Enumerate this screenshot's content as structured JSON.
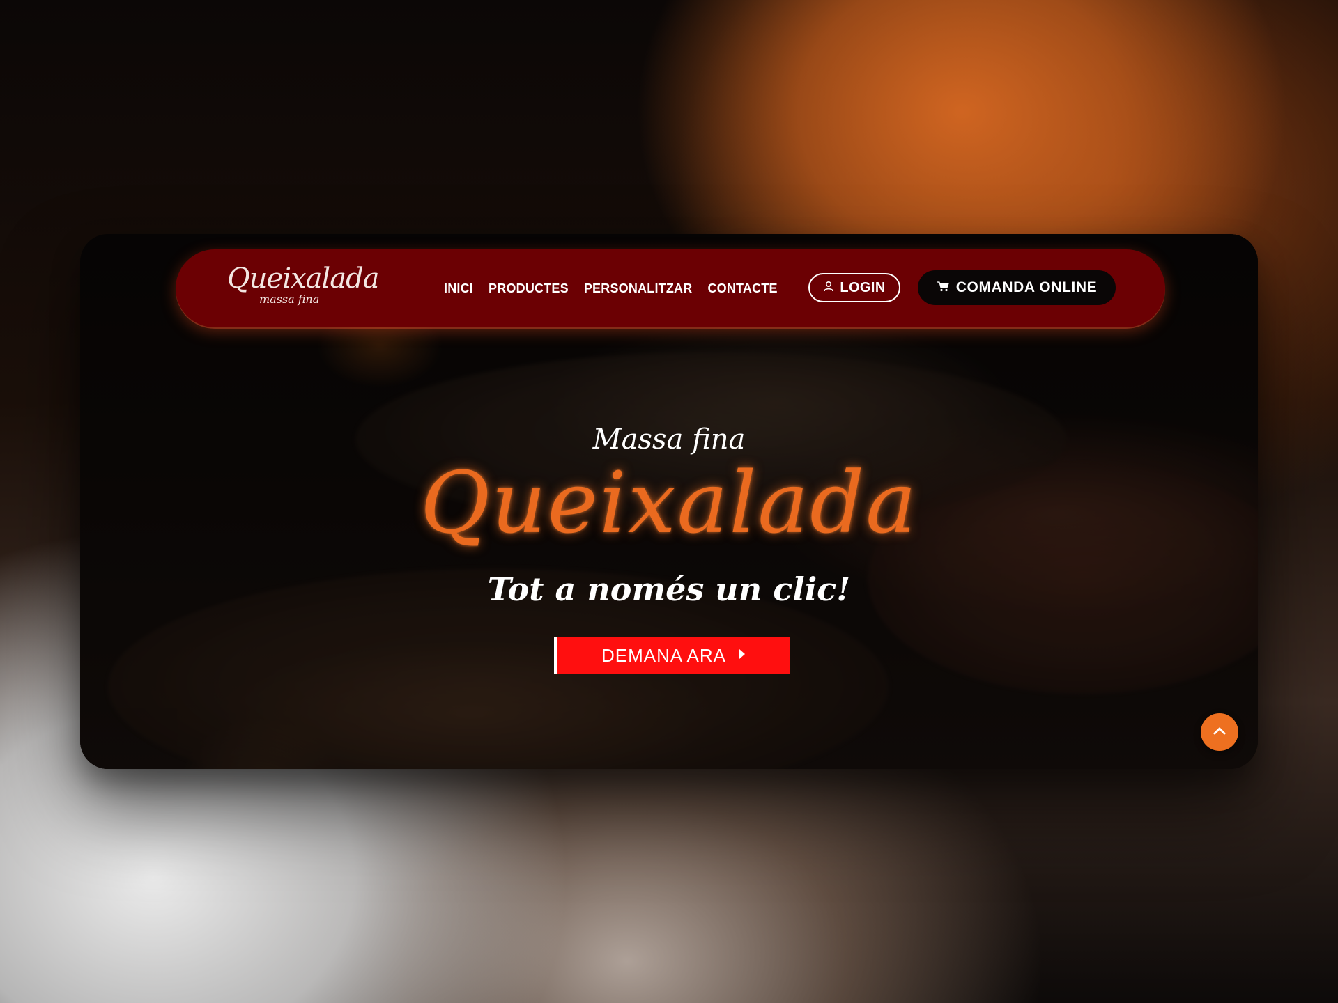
{
  "brand": {
    "logo_main": "Queixalada",
    "logo_sub": "massa fina"
  },
  "nav": {
    "links": [
      "INICI",
      "PRODUCTES",
      "PERSONALITZAR",
      "CONTACTE"
    ],
    "login_label": "LOGIN",
    "order_label": "COMANDA ONLINE"
  },
  "hero": {
    "subtitle": "Massa fina",
    "title": "Queixalada",
    "tagline": "Tot a només un clic!",
    "cta_label": "DEMANA ARA"
  },
  "icons": {
    "login": "user-icon",
    "order": "cart-icon",
    "cta": "caret-right-icon",
    "scroll_top": "chevron-up-icon"
  },
  "colors": {
    "nav_background": "#6b0003",
    "accent_orange": "#ea6a1f",
    "cta_red": "#ff0f0f",
    "order_button": "#0a0606",
    "scroll_button": "#ee7020"
  }
}
